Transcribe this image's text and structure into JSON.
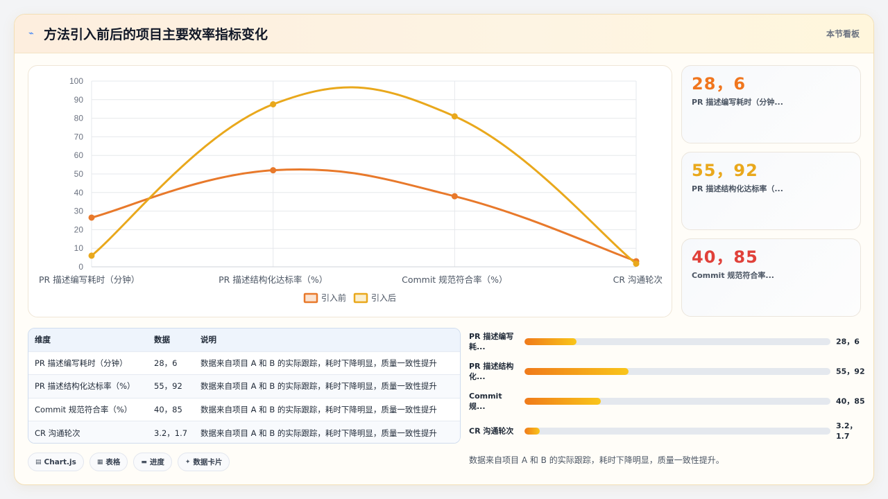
{
  "header": {
    "icon": "chart-line-icon",
    "title": "方法引入前后的项目主要效率指标变化",
    "badge": "本节看板"
  },
  "colors": {
    "before": "#e8792b",
    "after": "#e9a81c",
    "stat1": "#f0761e",
    "stat2": "#e9a81c",
    "stat3": "#e0413a"
  },
  "chart_data": {
    "type": "line",
    "categories": [
      "PR 描述编写耗时（分钟）",
      "PR 描述结构化达标率（%）",
      "Commit 规范符合率（%）",
      "CR 沟通轮次"
    ],
    "series": [
      {
        "name": "引入前",
        "values": [
          26.5,
          52,
          38,
          3
        ]
      },
      {
        "name": "引入后",
        "values": [
          6,
          87.5,
          81,
          1.7
        ]
      }
    ],
    "ylim": [
      0,
      100
    ],
    "yticks": [
      0,
      10,
      20,
      30,
      40,
      50,
      60,
      70,
      80,
      90,
      100
    ],
    "grid": true,
    "smooth": true,
    "legend": "bottom"
  },
  "stats": [
    {
      "value": "28，6",
      "label": "PR 描述编写耗时（分钟..."
    },
    {
      "value": "55，92",
      "label": "PR 描述结构化达标率（..."
    },
    {
      "value": "40，85",
      "label": "Commit 规范符合率..."
    }
  ],
  "table": {
    "headers": [
      "维度",
      "数据",
      "说明"
    ],
    "rows": [
      [
        "PR 描述编写耗时（分钟）",
        "28，6",
        "数据来自项目 A 和 B 的实际跟踪，耗时下降明显，质量一致性提升"
      ],
      [
        "PR 描述结构化达标率（%）",
        "55，92",
        "数据来自项目 A 和 B 的实际跟踪，耗时下降明显，质量一致性提升"
      ],
      [
        "Commit 规范符合率（%）",
        "40，85",
        "数据来自项目 A 和 B 的实际跟踪，耗时下降明显，质量一致性提升"
      ],
      [
        "CR 沟通轮次",
        "3.2，1.7",
        "数据来自项目 A 和 B 的实际跟踪，耗时下降明显，质量一致性提升"
      ]
    ]
  },
  "chips": [
    {
      "icon": "chart-icon",
      "glyph": "▤",
      "label": "Chart.js"
    },
    {
      "icon": "table-icon",
      "glyph": "▦",
      "label": "表格"
    },
    {
      "icon": "progress-icon",
      "glyph": "▬",
      "label": "进度"
    },
    {
      "icon": "sparkle-icon",
      "glyph": "✦",
      "label": "数据卡片"
    }
  ],
  "progress": [
    {
      "label": "PR 描述编写耗...",
      "value": "28，6",
      "fraction": 0.17
    },
    {
      "label": "PR 描述结构化...",
      "value": "55，92",
      "fraction": 0.34
    },
    {
      "label": "Commit 规...",
      "value": "40，85",
      "fraction": 0.25
    },
    {
      "label": "CR 沟通轮次",
      "value": "3.2，1.7",
      "fraction": 0.05
    }
  ],
  "note": "数据来自项目 A 和 B 的实际跟踪，耗时下降明显，质量一致性提升。"
}
